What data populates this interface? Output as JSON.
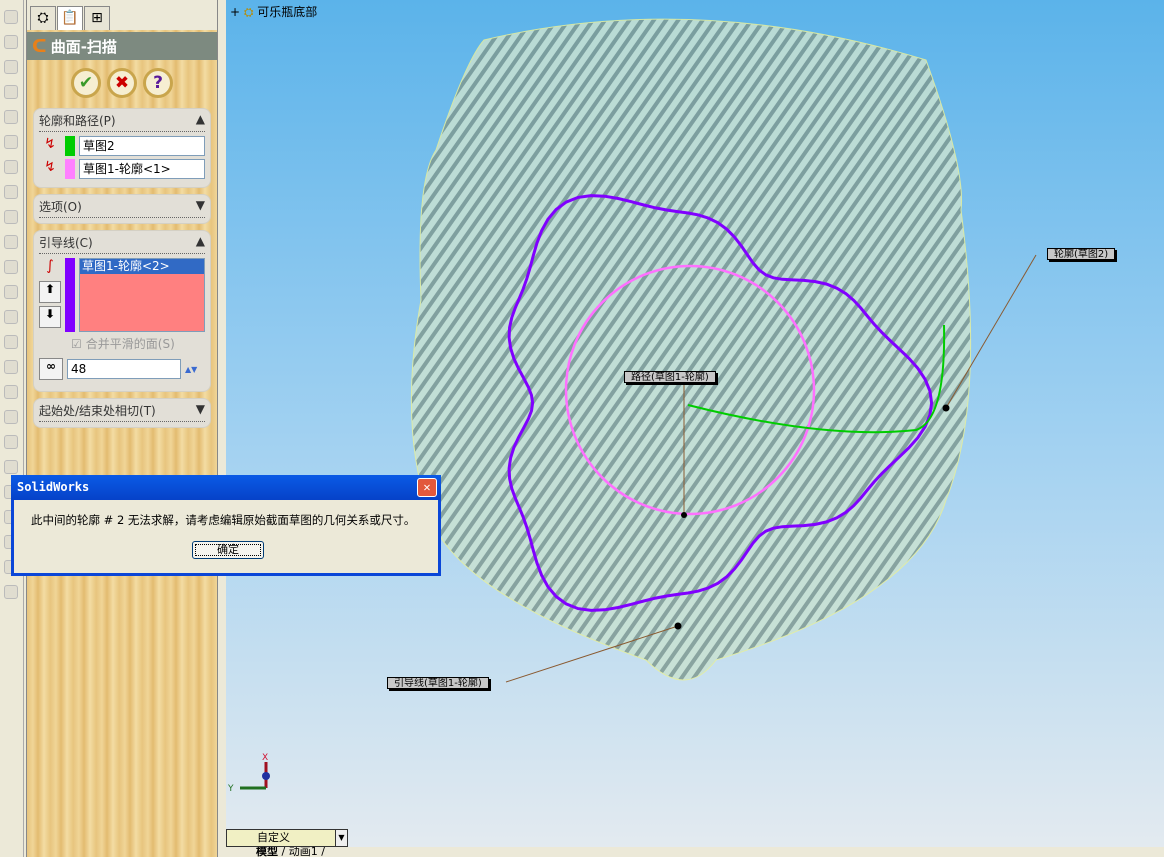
{
  "panel": {
    "tabs": [
      "feature-manager-icon",
      "property-manager-icon",
      "configuration-manager-icon"
    ],
    "title": "曲面-扫描",
    "buttons": {
      "ok": "✔",
      "cancel": "✖",
      "help": "?"
    },
    "profile_path": {
      "header": "轮廓和路径(P)",
      "profile": "草图2",
      "path": "草图1-轮廓<1>",
      "profile_color": "#00cc00",
      "path_color": "#ff80ff"
    },
    "options": {
      "header": "选项(O)"
    },
    "guides": {
      "header": "引导线(C)",
      "items": [
        "草图1-轮廓<2>"
      ],
      "color": "#8000ff",
      "merge_label": "合并平滑的面(S)",
      "merge_checked": true,
      "count": "48"
    },
    "tangency": {
      "header": "起始处/结束处相切(T)"
    }
  },
  "viewport": {
    "tree_item": "可乐瓶底部",
    "callouts": {
      "path": "路径(草图1-轮廓)",
      "profile": "轮廓(草图2)",
      "guide": "引导线(草图1-轮廓)"
    },
    "axes": {
      "x": "X",
      "y": "Y"
    },
    "view_select": "自定义"
  },
  "dialog": {
    "title": "SolidWorks",
    "message": "此中间的轮廓 # 2 无法求解，请考虑编辑原始截面草图的几何关系或尺寸。",
    "ok": "确定"
  },
  "bottom_tabs": [
    "模型",
    "动画1"
  ]
}
